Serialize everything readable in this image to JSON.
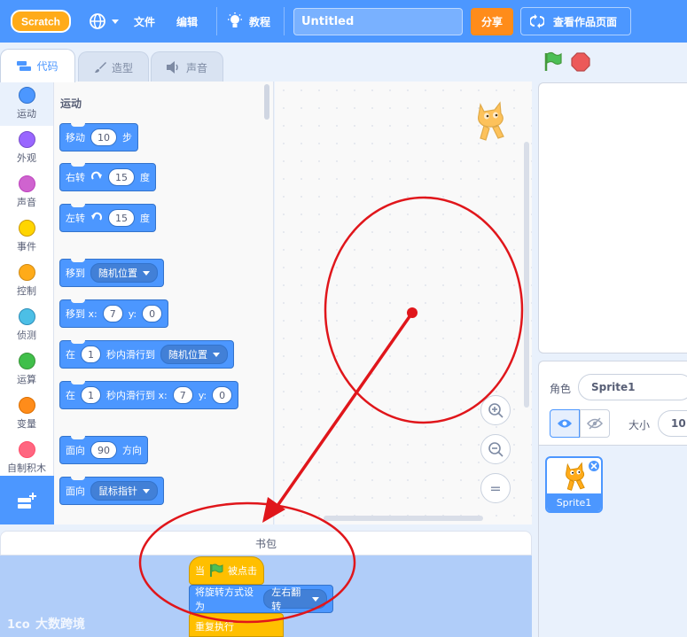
{
  "menu": {
    "logo_text": "Scratch",
    "file": "文件",
    "edit": "编辑",
    "tutorials": "教程",
    "project_title": "Untitled",
    "share": "分享",
    "see_project": "查看作品页面"
  },
  "tabs": {
    "code": "代码",
    "costumes": "造型",
    "sounds": "声音"
  },
  "categories": [
    {
      "label": "运动",
      "color": "#4c97ff"
    },
    {
      "label": "外观",
      "color": "#9966ff"
    },
    {
      "label": "声音",
      "color": "#cf63cf"
    },
    {
      "label": "事件",
      "color": "#ffd500"
    },
    {
      "label": "控制",
      "color": "#ffab19"
    },
    {
      "label": "侦测",
      "color": "#4cbfe6"
    },
    {
      "label": "运算",
      "color": "#40bf4a"
    },
    {
      "label": "变量",
      "color": "#ff8c1a"
    },
    {
      "label": "自制积木",
      "color": "#ff6680"
    }
  ],
  "palette": {
    "heading": "运动",
    "move": {
      "pre": "移动",
      "value": "10",
      "post": "步"
    },
    "turn_right": {
      "pre": "右转",
      "value": "15",
      "post": "度"
    },
    "turn_left": {
      "pre": "左转",
      "value": "15",
      "post": "度"
    },
    "goto": {
      "pre": "移到",
      "menu": "随机位置"
    },
    "goto_xy": {
      "pre": "移到 x:",
      "x": "7",
      "ylabel": "y:",
      "y": "0"
    },
    "glide": {
      "pre": "在",
      "value": "1",
      "mid": "秒内滑行到",
      "menu": "随机位置"
    },
    "glide_xy": {
      "pre": "在",
      "value": "1",
      "mid": "秒内滑行到 x:",
      "x": "7",
      "ylabel": "y:",
      "y": "0"
    },
    "point_dir": {
      "pre": "面向",
      "value": "90",
      "post": "方向"
    },
    "point_towards": {
      "pre": "面向",
      "menu": "鼠标指针"
    }
  },
  "zoom": {
    "reset": "="
  },
  "backpack": {
    "title": "书包",
    "when_flag": {
      "pre": "当",
      "post": "被点击"
    },
    "rotation": {
      "pre": "将旋转方式设为",
      "menu": "左右翻转"
    },
    "partial_block": "重复执行"
  },
  "watermark": "大数跨境",
  "sprite_info": {
    "sprite_label": "角色",
    "sprite_name": "Sprite1",
    "size_label": "大小",
    "size_value": "10"
  },
  "sprites": [
    {
      "name": "Sprite1"
    }
  ]
}
